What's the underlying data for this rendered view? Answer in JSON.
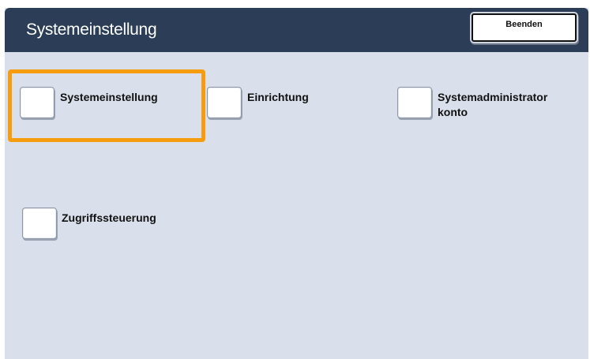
{
  "header": {
    "title": "Systemeinstellung",
    "close_label": "Beenden"
  },
  "options": [
    {
      "label": "Systemeinstellung",
      "selected": true
    },
    {
      "label": "Einrichtung",
      "selected": false
    },
    {
      "label_line1": "Systemadministrator",
      "label_line2": "konto",
      "selected": false
    },
    {
      "label": "Zugriffssteuerung",
      "selected": false
    }
  ],
  "colors": {
    "header_bg": "#2c3e57",
    "panel_bg": "#d9e0eb",
    "selection_highlight": "#f59d0f"
  }
}
